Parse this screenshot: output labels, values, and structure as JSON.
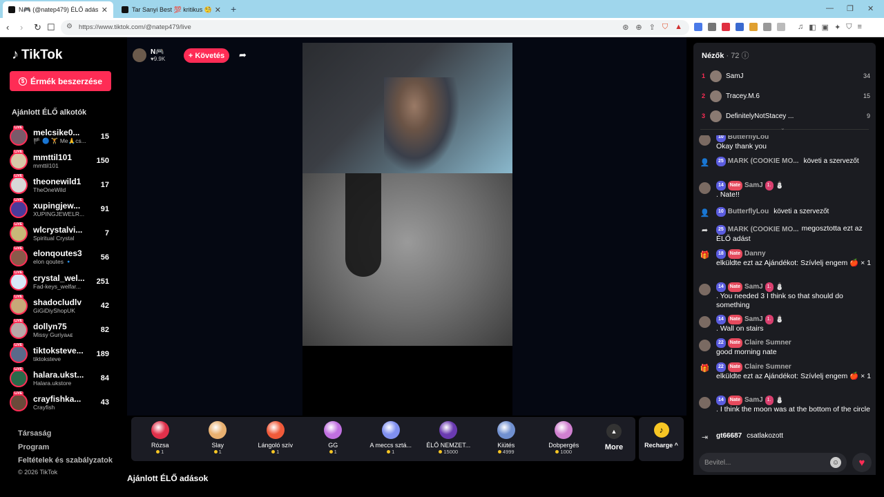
{
  "browser": {
    "tabs": [
      {
        "title": "N🎮 (@natep479) ÉLŐ adás",
        "active": true
      },
      {
        "title": "Tar Sanyi Best 💯 kritikus 🧐 (@szop",
        "active": false
      }
    ],
    "url": "https://www.tiktok.com/@natep479/live"
  },
  "sidebar": {
    "logo": "TikTok",
    "coin_button": "Érmék beszerzése",
    "recommended_heading": "Ajánlott ÉLŐ alkotók",
    "live_badge": "LIVE",
    "creators": [
      {
        "name": "melcsike0...",
        "sub": "🏴 🔵 🏋️ Me🙏cs...",
        "count": "15",
        "color": "#7a5a6a"
      },
      {
        "name": "mmttil101",
        "sub": "mmttil101",
        "count": "150",
        "color": "#d8c8a8"
      },
      {
        "name": "theonewild1",
        "sub": "TheOneWild",
        "count": "17",
        "color": "#d8d8d8"
      },
      {
        "name": "xupingjew...",
        "sub": "XUPINGJEWELR...",
        "count": "91",
        "color": "#4a3a9a"
      },
      {
        "name": "wlcrystalvi...",
        "sub": "Spiritual Crystal",
        "count": "7",
        "color": "#c8b878"
      },
      {
        "name": "elonqoutes3",
        "sub": "elon qoutes 🔹",
        "count": "56",
        "color": "#8a5a4a"
      },
      {
        "name": "crystal_wel...",
        "sub": "Fad-keys_welfar...",
        "count": "251",
        "color": "#d8e8f8"
      },
      {
        "name": "shadocludlv",
        "sub": "GiGiDiyShopUK",
        "count": "42",
        "color": "#c8a878"
      },
      {
        "name": "dollyn75",
        "sub": "Missy Guriyaᴀᴇ",
        "count": "82",
        "color": "#b8a8a8"
      },
      {
        "name": "tiktoksteve...",
        "sub": "tiktoksteve",
        "count": "189",
        "color": "#5a6a8a"
      },
      {
        "name": "halara.ukst...",
        "sub": "Halara.ukstore",
        "count": "84",
        "color": "#2a6a4a"
      },
      {
        "name": "crayfishka...",
        "sub": "Crayfish",
        "count": "43",
        "color": "#6a4a3a"
      }
    ],
    "footer_links": [
      "Társaság",
      "Program",
      "Feltételek és szabályzatok"
    ],
    "copyright": "© 2026 TikTok"
  },
  "stream": {
    "streamer_name": "N🎮",
    "likes": "♥9.9K",
    "follow_label": "+ Követés",
    "recommended_live": "Ajánlott ÉLŐ adások"
  },
  "gifts": [
    {
      "name": "Rózsa",
      "price": "1",
      "color": "#e0304a"
    },
    {
      "name": "Slay",
      "price": "1",
      "color": "#e8b070"
    },
    {
      "name": "Lángoló szív",
      "price": "1",
      "color": "#f05a3a"
    },
    {
      "name": "GG",
      "price": "1",
      "color": "#c070e0"
    },
    {
      "name": "A meccs sztá...",
      "price": "1",
      "color": "#8090f0"
    },
    {
      "name": "ÉLŐ NEMZET...",
      "price": "15000",
      "color": "#6a3ab0"
    },
    {
      "name": "Kiütés",
      "price": "4999",
      "color": "#7090d0"
    },
    {
      "name": "Dobpergés",
      "price": "1000",
      "color": "#d080d0"
    }
  ],
  "more_label": "More",
  "recharge_label": "Recharge ^",
  "viewers": {
    "heading": "Nézők",
    "count": "· 72",
    "top": [
      {
        "rank": "1",
        "name": "SamJ",
        "score": "34"
      },
      {
        "rank": "2",
        "name": "Tracey.M.6",
        "score": "15"
      },
      {
        "rank": "3",
        "name": "DefinitelyNotStacey ...",
        "score": "9"
      }
    ]
  },
  "chat": [
    {
      "level": "10",
      "user": "ButterflyLou",
      "text": "Okay thank you"
    },
    {
      "level": "25",
      "user": "MARK (COOKIE MO...",
      "text": "követi a szervezőt"
    },
    {
      "level": "14",
      "fan": "Nate",
      "mod": "1.",
      "user": "SamJ",
      "text": ". Nate!!"
    },
    {
      "level": "10",
      "user": "ButterflyLou",
      "text": "követi a szervezőt"
    },
    {
      "level": "25",
      "user": "MARK (COOKIE MO...",
      "text": "megosztotta ezt az ÉLŐ adást"
    },
    {
      "level": "18",
      "fan": "Nate",
      "user": "Danny",
      "text": "elküldte ezt az Ajándékot: Szívlelj engem 🍎 × 1"
    },
    {
      "level": "14",
      "fan": "Nate",
      "mod": "1.",
      "user": "SamJ",
      "text": ". You needed 3 I think so that should do something"
    },
    {
      "level": "14",
      "fan": "Nate",
      "mod": "1.",
      "user": "SamJ",
      "text": ". Wall on stairs"
    },
    {
      "level": "22",
      "fan": "Nate",
      "user": "Claire Sumner",
      "text": "good morning nate"
    },
    {
      "level": "22",
      "fan": "Nate",
      "user": "Claire Sumner",
      "text": "elküldte ezt az Ajándékot: Szívlelj engem 🍎 × 1"
    },
    {
      "level": "14",
      "fan": "Nate",
      "mod": "1.",
      "user": "SamJ",
      "text": ". I think the moon was at the bottom of the circle"
    },
    {
      "user": "gt66687",
      "text": "csatlakozott"
    }
  ],
  "input_placeholder": "Bevitel..."
}
